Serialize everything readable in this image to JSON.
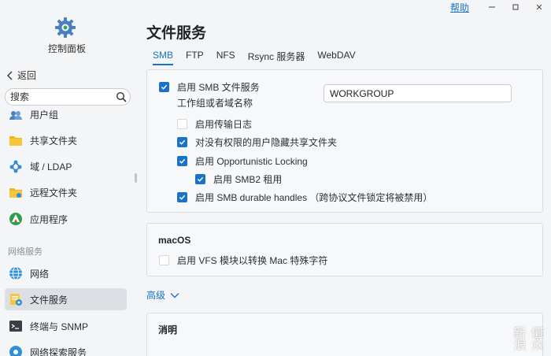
{
  "sidebar": {
    "app_title": "控制面板",
    "back_label": "返回",
    "search_placeholder": "搜索",
    "section_network": "网络服务",
    "items": [
      {
        "label": "用户组",
        "icon": "user-group-icon"
      },
      {
        "label": "共享文件夹",
        "icon": "shared-folder-icon"
      },
      {
        "label": "域 / LDAP",
        "icon": "domain-ldap-icon"
      },
      {
        "label": "远程文件夹",
        "icon": "remote-folder-icon"
      },
      {
        "label": "应用程序",
        "icon": "applications-icon"
      },
      {
        "label": "网络",
        "icon": "network-globe-icon"
      },
      {
        "label": "文件服务",
        "icon": "file-services-icon",
        "active": true
      },
      {
        "label": "终端与 SNMP",
        "icon": "terminal-icon"
      },
      {
        "label": "网络探索服务",
        "icon": "network-discovery-icon"
      }
    ]
  },
  "topbar": {
    "help_label": "帮助"
  },
  "main": {
    "title": "文件服务",
    "tabs": [
      "SMB",
      "FTP",
      "NFS",
      "Rsync 服务器",
      "WebDAV"
    ],
    "active_tab": "SMB",
    "smb_panel": {
      "enable_smb": {
        "label": "启用 SMB 文件服务",
        "checked": true
      },
      "workgroup_label": "工作组或者域名称",
      "workgroup_value": "WORKGROUP",
      "transfer_log": {
        "label": "启用传输日志",
        "checked": false
      },
      "hide_folders": {
        "label": "对没有权限的用户隐藏共享文件夹",
        "checked": true
      },
      "oplocks": {
        "label": "启用 Opportunistic Locking",
        "checked": true
      },
      "smb2_lease": {
        "label": "启用 SMB2 租用",
        "checked": true
      },
      "durable_handles": {
        "label": "启用 SMB durable handles （跨协议文件锁定将被禁用）",
        "checked": true
      }
    },
    "macos_panel": {
      "heading": "macOS",
      "vfs": {
        "label": "启用 VFS 模块以转换 Mac 特殊字符",
        "checked": false
      }
    },
    "advanced_label": "高级",
    "partial_heading": "消明"
  },
  "watermark": {
    "line1": "新 值",
    "line2": "浪 众"
  },
  "colors": {
    "accent": "#1a73c8",
    "background": "#f4f5f7",
    "active_nav": "#dcdfe4"
  }
}
